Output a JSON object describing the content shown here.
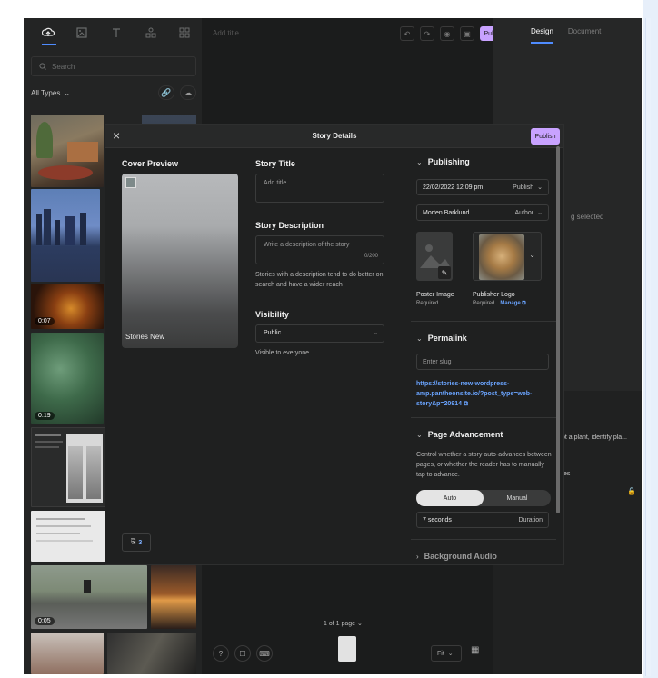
{
  "library": {
    "search_placeholder": "Search",
    "types_label": "All Types",
    "durations": [
      "0:07",
      "0:19",
      "0:05"
    ]
  },
  "editor": {
    "title_placeholder": "Add title",
    "publish_label": "Publish",
    "page_count": "1 of 1 page",
    "zoom_label": "Fit"
  },
  "right_panel": {
    "tabs": [
      "Design",
      "Document"
    ],
    "message": "g selected",
    "lower_text_1": "pt a plant, identify pla...",
    "lower_text_2": "tes"
  },
  "modal": {
    "title": "Story Details",
    "publish_label": "Publish",
    "cover": {
      "label": "Cover Preview",
      "story_name": "Stories New"
    },
    "pages_count": "3",
    "story_title": {
      "label": "Story Title",
      "placeholder": "Add title"
    },
    "story_description": {
      "label": "Story Description",
      "placeholder": "Write a description of the story",
      "counter": "0/200",
      "hint": "Stories with a description tend to do better on search and have a wider reach"
    },
    "visibility": {
      "label": "Visibility",
      "value": "Public",
      "hint": "Visible to everyone"
    },
    "publishing": {
      "label": "Publishing",
      "date_value": "22/02/2022 12:09 pm",
      "date_kind": "Publish",
      "author_value": "Morten Barklund",
      "author_kind": "Author",
      "poster_caption": "Poster Image",
      "poster_sub": "Required",
      "logo_caption": "Publisher Logo",
      "logo_sub": "Required",
      "manage_label": "Manage"
    },
    "permalink": {
      "label": "Permalink",
      "slug_placeholder": "Enter slug",
      "url": "https://stories-new-wordpress-amp.pantheonsite.io/?post_type=web-story&p=20914"
    },
    "page_advancement": {
      "label": "Page Advancement",
      "description": "Control whether a story auto-advances between pages, or whether the reader has to manually tap to advance.",
      "option_auto": "Auto",
      "option_manual": "Manual",
      "duration_value": "7 seconds",
      "duration_label": "Duration"
    },
    "background_audio": {
      "label": "Background Audio"
    }
  },
  "colors": {
    "accent": "#4f8cff",
    "publish": "#c8a2ff",
    "link": "#6aa4ff"
  }
}
